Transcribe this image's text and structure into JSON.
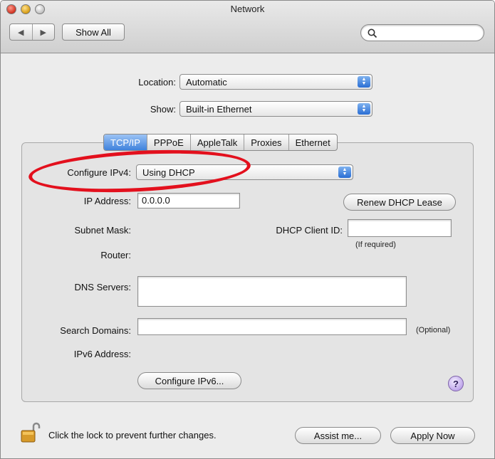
{
  "window": {
    "title": "Network"
  },
  "toolbar": {
    "show_all": "Show All",
    "back": "◀",
    "forward": "▶"
  },
  "location": {
    "label": "Location:",
    "value": "Automatic"
  },
  "show": {
    "label": "Show:",
    "value": "Built-in Ethernet"
  },
  "tabs": [
    {
      "label": "TCP/IP",
      "selected": true
    },
    {
      "label": "PPPoE"
    },
    {
      "label": "AppleTalk"
    },
    {
      "label": "Proxies"
    },
    {
      "label": "Ethernet"
    }
  ],
  "tcpip": {
    "configure_ipv4": {
      "label": "Configure IPv4:",
      "value": "Using DHCP"
    },
    "ip_address": {
      "label": "IP Address:",
      "value": "0.0.0.0"
    },
    "renew_button": "Renew DHCP Lease",
    "subnet_mask": {
      "label": "Subnet Mask:"
    },
    "dhcp_client_id": {
      "label": "DHCP Client ID:",
      "hint": "(If required)"
    },
    "router": {
      "label": "Router:"
    },
    "dns_servers": {
      "label": "DNS Servers:"
    },
    "search_domains": {
      "label": "Search Domains:",
      "hint": "(Optional)"
    },
    "ipv6_address": {
      "label": "IPv6 Address:"
    },
    "configure_ipv6_button": "Configure IPv6...",
    "help": "?"
  },
  "footer": {
    "lock_text": "Click the lock to prevent further changes.",
    "assist_button": "Assist me...",
    "apply_button": "Apply Now"
  },
  "colors": {
    "accent": "#3f82dc",
    "annotation": "#e3101d"
  }
}
